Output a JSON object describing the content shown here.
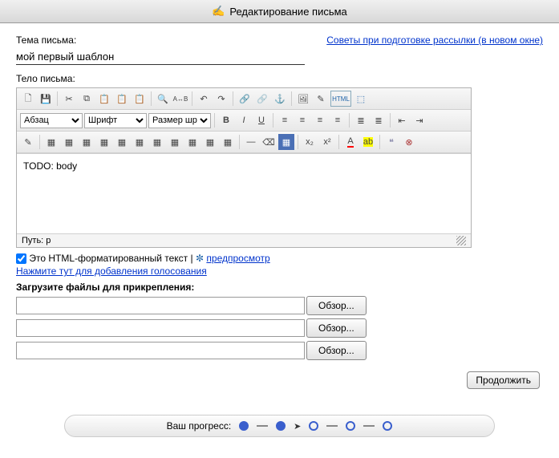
{
  "header": {
    "title": "Редактирование письма"
  },
  "subject": {
    "label": "Тема письма:",
    "value": "мой первый шаблон"
  },
  "tips_link": "Советы при подготовке рассылки (в новом окне)",
  "body_label": "Тело письма:",
  "formats": {
    "paragraph": "Абзац",
    "font": "Шрифт",
    "size": "Размер шри"
  },
  "editor_body": "TODO: body",
  "path_label": "Путь: p",
  "html_label": "HTML",
  "html_checkbox_label": "Это HTML-форматированный текст",
  "preview_link": "предпросмотр",
  "add_vote_link": "Нажмите тут для добавления голосования",
  "upload_label": "Загрузите файлы для прикрепления:",
  "browse_label": "Обзор...",
  "continue_label": "Продолжить",
  "progress_label": "Ваш прогресс:",
  "separator": " | ",
  "asterisk": "✼"
}
